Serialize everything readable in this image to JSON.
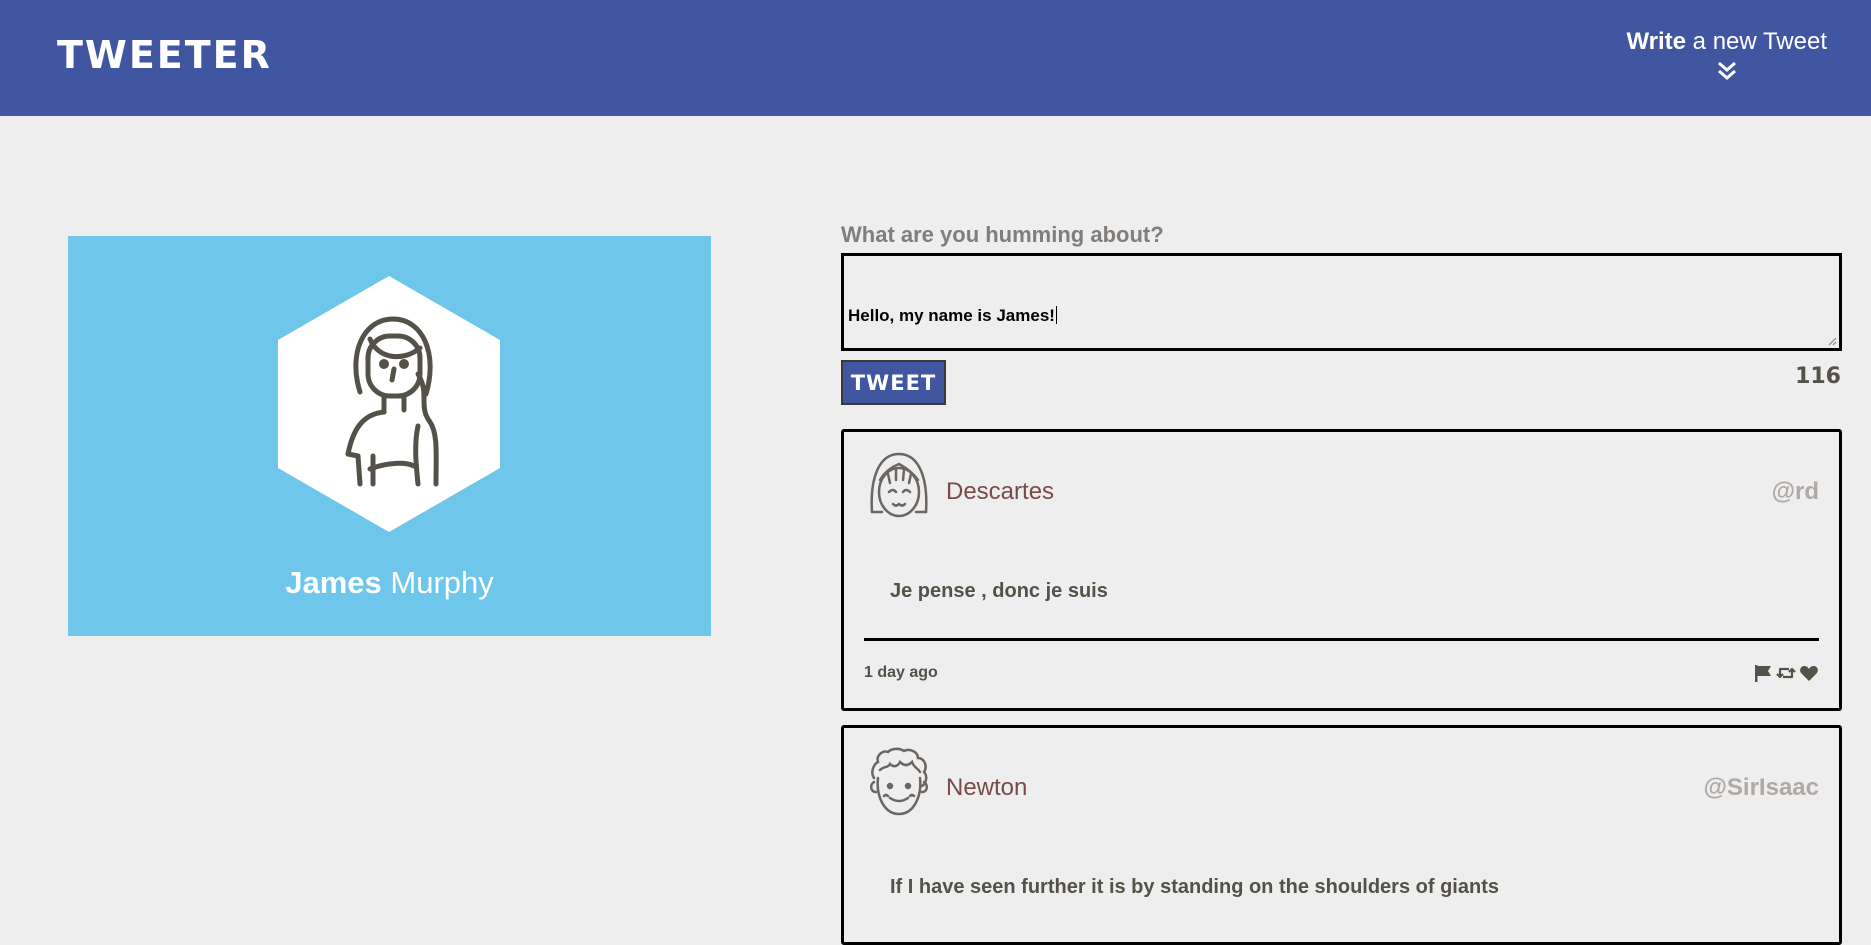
{
  "nav": {
    "logo": "TWEETER",
    "write_strong": "Write",
    "write_rest": " a new Tweet",
    "toggle_icon": "double-chevron-down-icon"
  },
  "profile": {
    "first_name": "James",
    "last_name": "Murphy",
    "avatar_icon": "woman-avatar-icon",
    "background_color": "#6ec6ea"
  },
  "compose": {
    "label": "What are you humming about?",
    "value": "Hello, my name is James!",
    "submit_label": "TWEET",
    "char_counter": "116"
  },
  "tweets": [
    {
      "author": "Descartes",
      "handle": "@rd",
      "avatar_icon": "girl-avatar-icon",
      "content": "Je pense , donc je suis",
      "timestamp": "1 day ago",
      "actions": [
        "flag-icon",
        "retweet-icon",
        "heart-icon"
      ]
    },
    {
      "author": "Newton",
      "handle": "@SirIsaac",
      "avatar_icon": "curly-hair-avatar-icon",
      "content": "If I have seen further it is by standing on the shoulders of giants"
    }
  ],
  "colors": {
    "nav_bg": "#4056a1",
    "page_bg": "#eeeeee",
    "text": "#545149",
    "author": "#7a4a48",
    "handle": "#b0a9a6"
  }
}
